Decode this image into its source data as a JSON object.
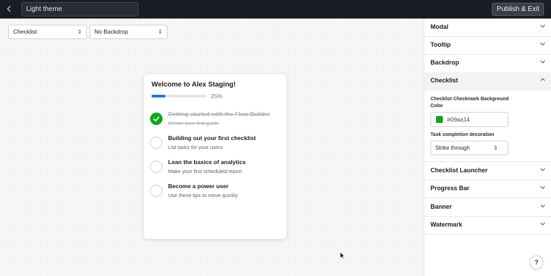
{
  "topbar": {
    "theme_name": "Light theme",
    "publish_label": "Publish & Exit"
  },
  "canvas": {
    "type_select": "Checklist",
    "backdrop_select": "No Backdrop"
  },
  "checklist": {
    "title": "Welcome to Alex Staging!",
    "progress_percent": 25,
    "progress_label": "25%",
    "tasks": [
      {
        "title": "Getting started with the Flow Builder",
        "description": "Create your first guide",
        "completed": true
      },
      {
        "title": "Building out your first checklist",
        "description": "List tasks for your users",
        "completed": false
      },
      {
        "title": "Lean the basics of analytics",
        "description": "Make your first scheduled report",
        "completed": false
      },
      {
        "title": "Become a power user",
        "description": "Use these tips to move quickly",
        "completed": false
      }
    ]
  },
  "panel": {
    "sections": [
      {
        "label": "Modal",
        "expanded": false
      },
      {
        "label": "Tooltip",
        "expanded": false
      },
      {
        "label": "Backdrop",
        "expanded": false
      },
      {
        "label": "Checklist",
        "expanded": true
      },
      {
        "label": "Checklist Launcher",
        "expanded": false
      },
      {
        "label": "Progress Bar",
        "expanded": false
      },
      {
        "label": "Banner",
        "expanded": false
      },
      {
        "label": "Watermark",
        "expanded": false
      }
    ],
    "checklist_settings": {
      "checkmark_color_label": "Checklist Checkmark Background Color",
      "checkmark_color_value": "#09aa14",
      "decoration_label": "Task completion decoration",
      "decoration_value": "Strike through"
    }
  },
  "help_label": "?",
  "colors": {
    "topbar_bg": "#1b1d24",
    "accent_blue": "#2f6fe4",
    "checkmark_green": "#09aa14"
  }
}
